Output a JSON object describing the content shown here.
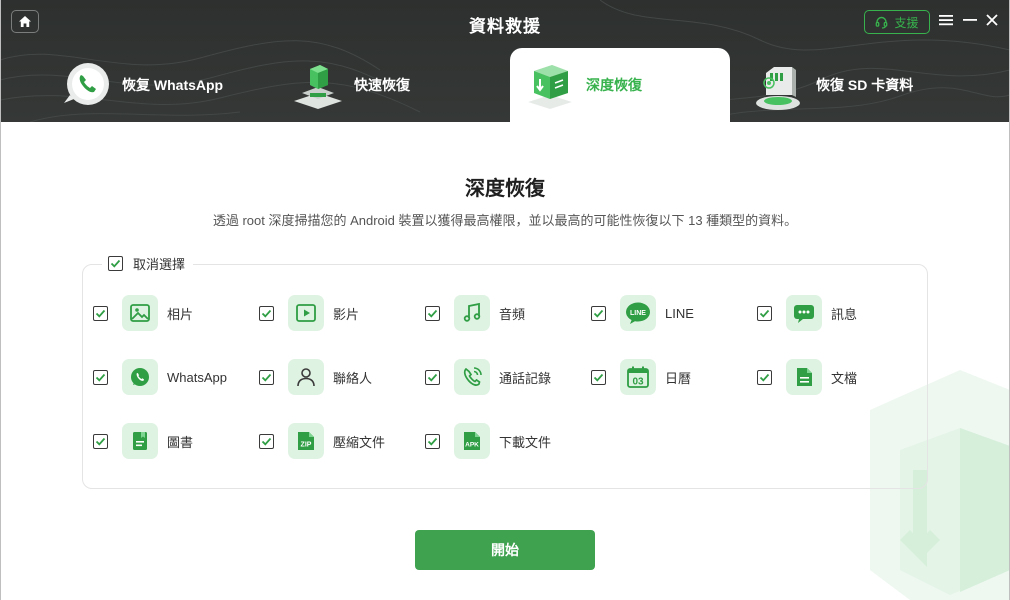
{
  "window": {
    "title": "資料救援",
    "support_label": "支援"
  },
  "tabs": [
    {
      "label": "恢复 WhatsApp",
      "icon": "whatsapp-phone-icon",
      "active": false
    },
    {
      "label": "快速恢復",
      "icon": "quick-recovery-cube-icon",
      "active": false
    },
    {
      "label": "深度恢復",
      "icon": "deep-recovery-cube-icon",
      "active": true
    },
    {
      "label": "恢復 SD 卡資料",
      "icon": "sd-card-icon",
      "active": false
    }
  ],
  "main": {
    "title": "深度恢復",
    "description": "透過 root 深度掃描您的 Android 裝置以獲得最高權限，並以最高的可能性恢復以下 13 種類型的資料。",
    "select_all_label": "取消選擇",
    "select_all_checked": true,
    "start_button": "開始"
  },
  "data_types": [
    {
      "label": "相片",
      "icon": "photo-icon",
      "checked": true
    },
    {
      "label": "影片",
      "icon": "video-icon",
      "checked": true
    },
    {
      "label": "音頻",
      "icon": "music-icon",
      "checked": true
    },
    {
      "label": "LINE",
      "icon": "line-icon",
      "checked": true
    },
    {
      "label": "訊息",
      "icon": "message-icon",
      "checked": true
    },
    {
      "label": "WhatsApp",
      "icon": "whatsapp-icon",
      "checked": true
    },
    {
      "label": "聯絡人",
      "icon": "contact-icon",
      "checked": true
    },
    {
      "label": "通話記錄",
      "icon": "call-log-icon",
      "checked": true
    },
    {
      "label": "日曆",
      "icon": "calendar-icon",
      "checked": true,
      "badge": "03"
    },
    {
      "label": "文檔",
      "icon": "document-icon",
      "checked": true
    },
    {
      "label": "圖書",
      "icon": "book-icon",
      "checked": true
    },
    {
      "label": "壓縮文件",
      "icon": "zip-icon",
      "checked": true,
      "badge": "ZIP"
    },
    {
      "label": "下載文件",
      "icon": "apk-icon",
      "checked": true,
      "badge": "APK"
    }
  ],
  "colors": {
    "accent": "#37b24d",
    "header_bg": "#323533",
    "button_bg": "#3ea24f",
    "icon_tile_bg": "#dff3e3"
  }
}
